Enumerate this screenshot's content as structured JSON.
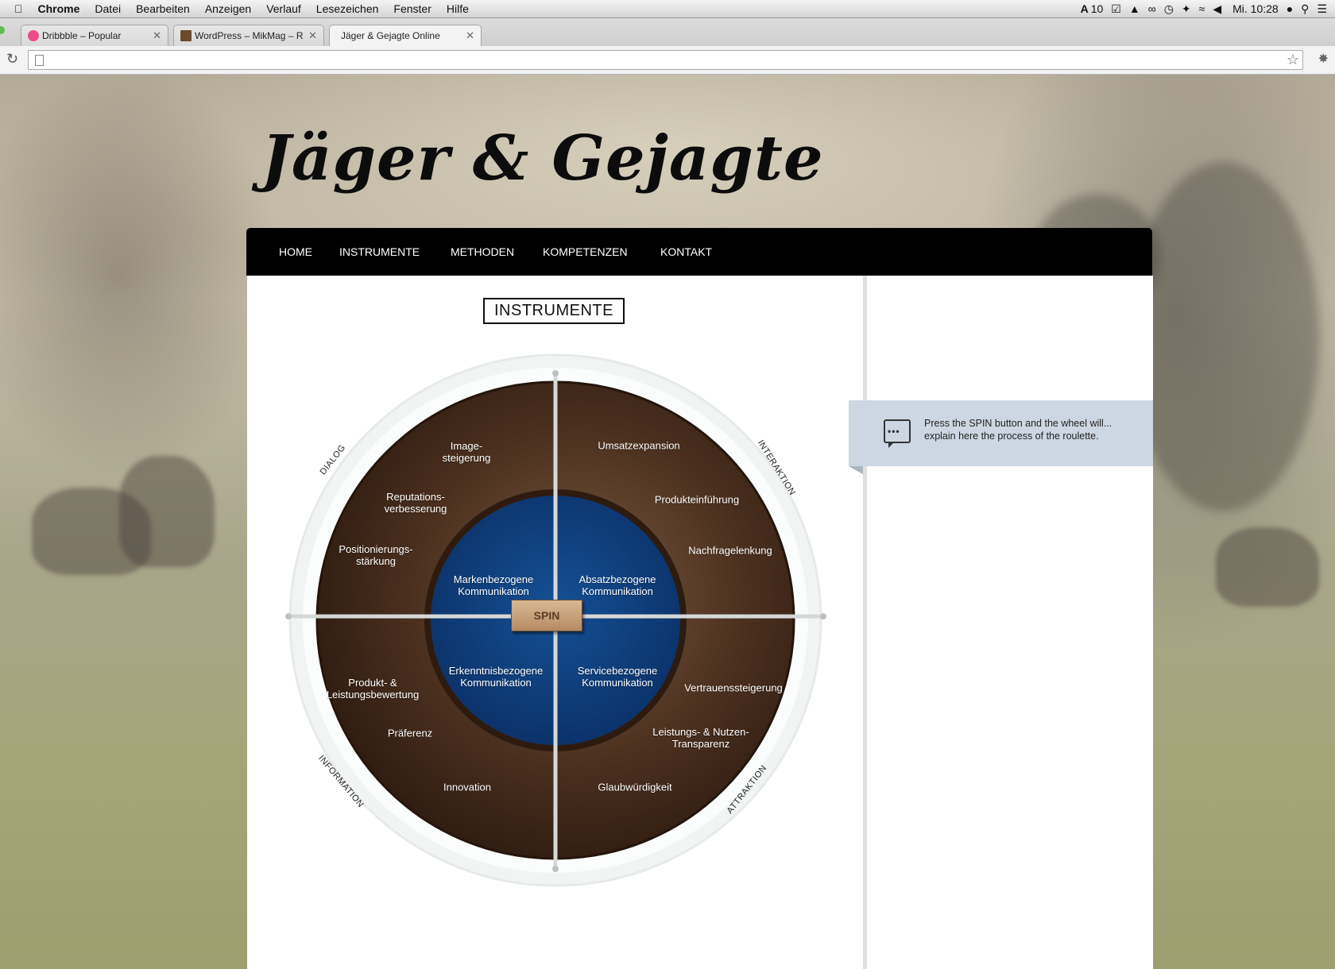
{
  "menubar": {
    "app": "Chrome",
    "menus": [
      "Datei",
      "Bearbeiten",
      "Anzeigen",
      "Verlauf",
      "Lesezeichen",
      "Fenster",
      "Hilfe"
    ],
    "status_badge": "10",
    "clock": "Mi. 10:28"
  },
  "tabs": [
    {
      "title": "Dribbble – Popular",
      "icon": "dribbble-icon",
      "color": "#ea4c89"
    },
    {
      "title": "WordPress – MikMag – Res",
      "icon": "wordpress-thumbnail-icon",
      "color": "#6b4a2e"
    },
    {
      "title": "Jäger & Gejagte Online",
      "icon": "",
      "color": ""
    }
  ],
  "omnibox": {
    "value": ""
  },
  "site": {
    "logo": "Jäger & Gejagte"
  },
  "nav": [
    "HOME",
    "INSTRUMENTE",
    "METHODEN",
    "KOMPETENZEN",
    "KONTAKT"
  ],
  "page": {
    "heading": "INSTRUMENTE"
  },
  "wheel": {
    "colors": {
      "wood": "#4a2f1e",
      "inner": "#0f3c78",
      "ring": "#f2f4f4"
    },
    "ring_labels": [
      "DIALOG",
      "INTERAKTION",
      "INFORMATION",
      "ATTRAKTION"
    ],
    "inner": [
      "Markenbezogene\nKommunikation",
      "Absatzbezogene\nKommunikation",
      "Erkenntnisbezogene\nKommunikation",
      "Servicebezogene\nKommunikation"
    ],
    "outer": [
      "Image-\nsteigerung",
      "Reputations-\nverbesserung",
      "Positionierungs-\nstärkung",
      "Umsatzexpansion",
      "Produkteinführung",
      "Nachfragelenkung",
      "Produkt- &\nLeistungsbewertung",
      "Präferenz",
      "Innovation",
      "Vertrauenssteigerung",
      "Leistungs- & Nutzen-\nTransparenz",
      "Glaubwürdigkeit"
    ],
    "spin": "SPIN"
  },
  "callout": {
    "text": "Press the SPIN button and the wheel will... explain here the process of the roulette.",
    "icon": "chat-bubble-icon"
  }
}
